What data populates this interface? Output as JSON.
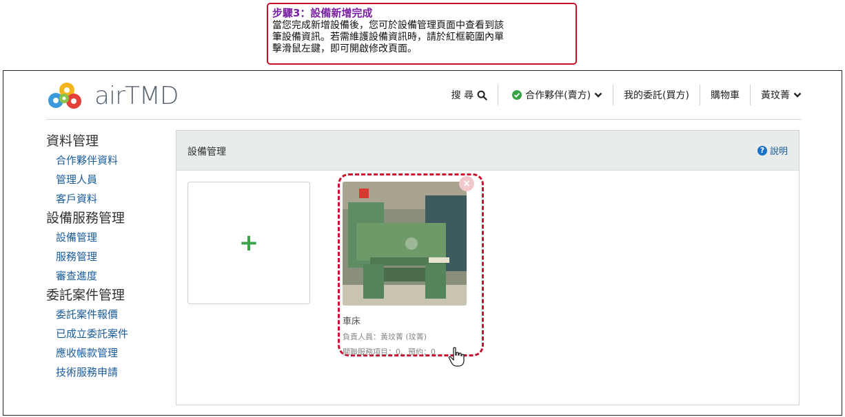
{
  "callout": {
    "title": "步驟3：設備新增完成",
    "lines": [
      "當您完成新增設備後，您可於設備管理頁面中查看到該",
      "筆設備資訊。若需維護設備資訊時，請於紅框範圍內單",
      "擊滑鼠左鍵，即可開啟修改頁面。"
    ]
  },
  "header": {
    "logo_text": "airTMD",
    "nav": {
      "search": "搜 尋",
      "partner": "合作夥伴(賣方)",
      "my_commission": "我的委託(買方)",
      "cart": "購物車",
      "user": "黃玟菁"
    }
  },
  "sidebar": {
    "groups": [
      {
        "title": "資料管理",
        "items": [
          "合作夥伴資料",
          "管理人員",
          "客戶資料"
        ]
      },
      {
        "title": "設備服務管理",
        "items": [
          "設備管理",
          "服務管理",
          "審查進度"
        ]
      },
      {
        "title": "委託案件管理",
        "items": [
          "委託案件報價",
          "已成立委託案件",
          "應收帳款管理",
          "技術服務申請"
        ]
      }
    ]
  },
  "panel": {
    "title": "設備管理",
    "help": "說明",
    "add_symbol": "+",
    "equipment": {
      "name": "車床",
      "owner": "負責人員：黃玟菁 (玟菁)",
      "related": "關聯服務項目：0、預約：0"
    }
  },
  "colors": {
    "accent_red": "#c8102e",
    "callout_title": "#7a1fa2",
    "link_blue": "#1a5b9b",
    "success_green": "#3aa247",
    "panel_header_bg": "#e8edec"
  }
}
